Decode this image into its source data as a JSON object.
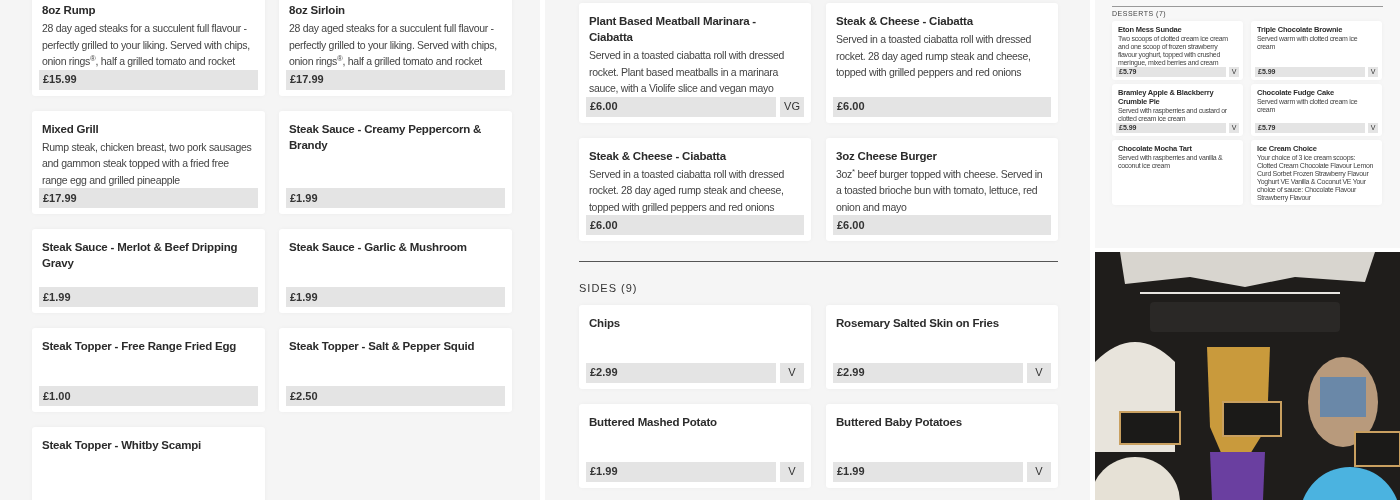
{
  "main_menu": {
    "items": [
      {
        "name": "8oz Rump",
        "description": "28 day aged steaks for a succulent full flavour - perfectly grilled to your liking. Served with chips, onion rings$^{®}$, half a grilled tomato and rocket",
        "price": "£15.99"
      },
      {
        "name": "8oz Sirloin",
        "description": "28 day aged steaks for a succulent full flavour - perfectly grilled to your liking. Served with chips, onion rings$^{®}$, half a grilled tomato and rocket",
        "price": "£17.99"
      },
      {
        "name": "Mixed Grill",
        "description": "Rump steak, chicken breast, two pork sausages and gammon steak topped with a fried free range egg and grilled pineapple",
        "price": "£17.99"
      },
      {
        "name": "Steak Sauce - Creamy Peppercorn & Brandy",
        "price": "£1.99"
      },
      {
        "name": "Steak Sauce - Merlot & Beef Dripping Gravy",
        "price": "£1.99"
      },
      {
        "name": "Steak Sauce - Garlic & Mushroom",
        "price": "£1.99"
      },
      {
        "name": "Steak Topper - Free Range Fried Egg",
        "price": "£1.00"
      },
      {
        "name": "Steak Topper - Salt & Pepper Squid",
        "price": "£2.50"
      },
      {
        "name": "Steak Topper - Whitby Scampi"
      }
    ]
  },
  "sandwiches": {
    "items": [
      {
        "name": "Plant Based Meatball Marinara - Ciabatta",
        "description": "Served in a toasted ciabatta roll with dressed rocket. Plant based meatballs in a marinara sauce, with a Violife slice and vegan mayo",
        "price": "£6.00",
        "tags": [
          "VG"
        ]
      },
      {
        "name": "Steak & Cheese - Ciabatta",
        "description": "Served in a toasted ciabatta roll with dressed rocket. 28 day aged rump steak and cheese, topped with grilled peppers and red onions",
        "price": "£6.00"
      },
      {
        "name": "Steak & Cheese - Ciabatta",
        "description": "Served in a toasted ciabatta roll with dressed rocket. 28 day aged rump steak and cheese, topped with grilled peppers and red onions",
        "price": "£6.00"
      },
      {
        "name": "3oz Cheese Burger",
        "description": "3oz$^{*}$ beef burger topped with cheese. Served in a toasted brioche bun with tomato, lettuce, red onion and mayo",
        "price": "£6.00"
      }
    ]
  },
  "sides": {
    "heading": "SIDES (9)",
    "items": [
      {
        "name": "Chips",
        "price": "£2.99",
        "tags": [
          "V"
        ]
      },
      {
        "name": "Rosemary Salted Skin on Fries",
        "price": "£2.99",
        "tags": [
          "V"
        ]
      },
      {
        "name": "Buttered Mashed Potato",
        "price": "£1.99",
        "tags": [
          "V"
        ]
      },
      {
        "name": "Buttered Baby Potatoes",
        "price": "£1.99",
        "tags": [
          "V"
        ]
      }
    ]
  },
  "desserts": {
    "heading": "DESSERTS (7)",
    "items": [
      {
        "name": "Eton Mess Sundae",
        "description": "Two scoops of clotted cream ice cream and one scoop of frozen strawberry flavour yoghurt, topped with crushed meringue, mixed berries and cream",
        "price": "£5.79",
        "tags": [
          "V"
        ]
      },
      {
        "name": "Triple Chocolate Brownie",
        "description": "Served warm with clotted cream ice cream",
        "price": "£5.99",
        "tags": [
          "V"
        ]
      },
      {
        "name": "Bramley Apple & Blackberry Crumble Pie",
        "description": "Served with raspberries and custard or clotted cream ice cream",
        "price": "£5.99",
        "tags": [
          "V"
        ]
      },
      {
        "name": "Chocolate Fudge Cake",
        "description": "Served warm with clotted cream ice cream",
        "price": "£5.79",
        "tags": [
          "V"
        ]
      },
      {
        "name": "Chocolate Mocha Tart",
        "description": "Served with raspberries and vanilla & coconut ice cream"
      },
      {
        "name": "Ice Cream Choice",
        "description": "Your choice of 3 ice cream scoops: Clotted Cream Chocolate Flavour Lemon Curd Sorbet Frozen Strawberry Flavour Yoghurt VE Vanilla & Coconut VE Your choice of sauce: Chocolate Flavour Strawberry Flavour"
      }
    ]
  }
}
